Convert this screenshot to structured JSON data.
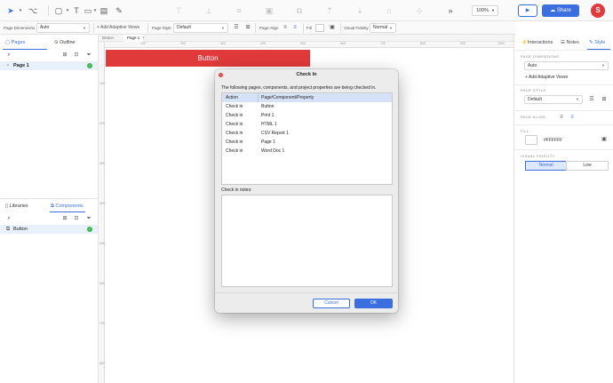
{
  "toolbar": {
    "zoom": "100%",
    "share_label": "Share",
    "user_initial": "S",
    "collapse_glyph": "»"
  },
  "propbar": {
    "page_dimensions_label": "Page Dimensions",
    "page_dimensions_value": "Auto",
    "adaptive_views_label": "+ Add Adaptive Views",
    "page_style_label": "Page Style",
    "page_style_value": "Default",
    "page_align_label": "Page Align",
    "fill_label": "Fill",
    "visual_fidelity_label": "Visual Fidelity",
    "visual_fidelity_value": "Normal"
  },
  "left": {
    "pages_tab": "Pages",
    "outline_tab": "Outline",
    "pages": [
      {
        "label": "Page 1"
      }
    ],
    "libraries_tab": "Libraries",
    "components_tab": "Components",
    "components": [
      {
        "label": "Button"
      }
    ]
  },
  "canvas": {
    "tabs": [
      "Button",
      "Page 1"
    ],
    "ruler_h": [
      "100",
      "200",
      "300",
      "400",
      "500",
      "600",
      "700",
      "800",
      "900",
      "1000"
    ],
    "ruler_v": [
      "100",
      "200",
      "300",
      "400",
      "500",
      "600",
      "700",
      "800"
    ],
    "widget_label": "Button"
  },
  "right": {
    "tabs": [
      "Interactions",
      "Notes",
      "Style"
    ],
    "page_dimensions_heading": "PAGE DIMENSIONS",
    "page_dimensions_value": "Auto",
    "add_adaptive_views": "+ Add Adaptive Views",
    "page_style_heading": "PAGE STYLE",
    "page_style_value": "Default",
    "page_align_heading": "PAGE ALIGN",
    "fill_heading": "FILL",
    "fill_value": "#FFFFFF",
    "visual_fidelity_heading": "VISUAL FIDELITY",
    "fidelity_options": [
      "Normal",
      "Low"
    ]
  },
  "dialog": {
    "title": "Check In",
    "info": "The following pages, components, and project properties are being checked in.",
    "columns": [
      "Action",
      "Page/Component/Property"
    ],
    "rows": [
      [
        "Check in",
        "Button"
      ],
      [
        "Check in",
        "Print 1"
      ],
      [
        "Check in",
        "HTML 1"
      ],
      [
        "Check in",
        "CSV Report 1"
      ],
      [
        "Check in",
        "Page 1"
      ],
      [
        "Check in",
        "Word Doc 1"
      ]
    ],
    "notes_label": "Check in notes:",
    "cancel_label": "Cancel",
    "ok_label": "OK"
  },
  "colors": {
    "accent": "#3b6fe0",
    "widget_red": "#e03a3a",
    "success": "#3bb54a"
  }
}
